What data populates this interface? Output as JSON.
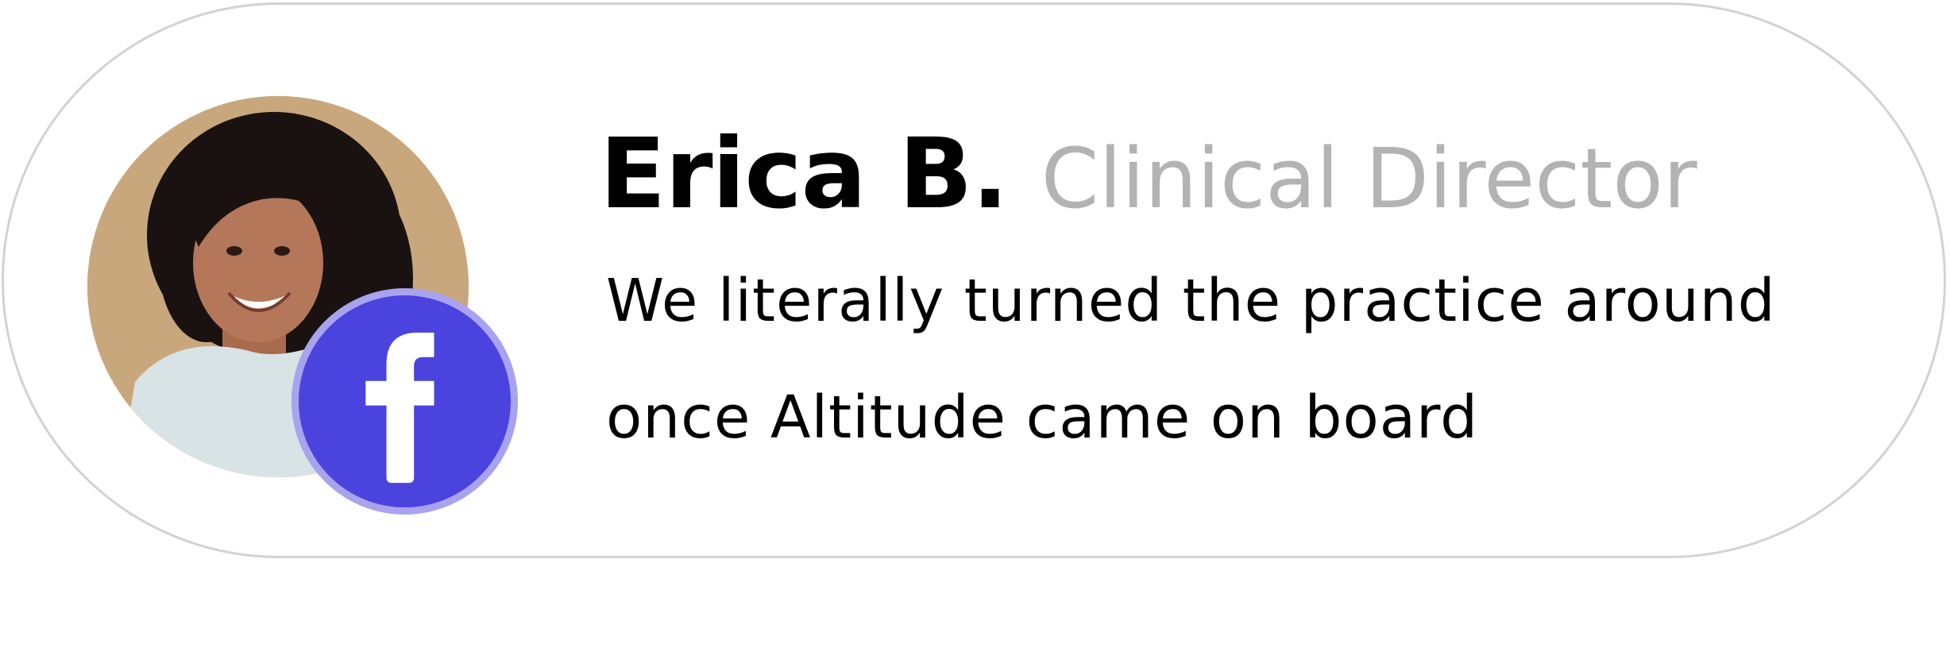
{
  "testimonial": {
    "name": "Erica B.",
    "role": "Clinical Director",
    "quote": "We literally turned the practice around once Altitude came on board"
  },
  "badge": {
    "icon": "facebook-icon",
    "color": "#4b43de",
    "ring_color": "#a8a3ee"
  },
  "colors": {
    "card_border": "#d2d2d2",
    "name": "#000000",
    "role": "#b3b3b3",
    "photo_background": "#c9a77d"
  }
}
